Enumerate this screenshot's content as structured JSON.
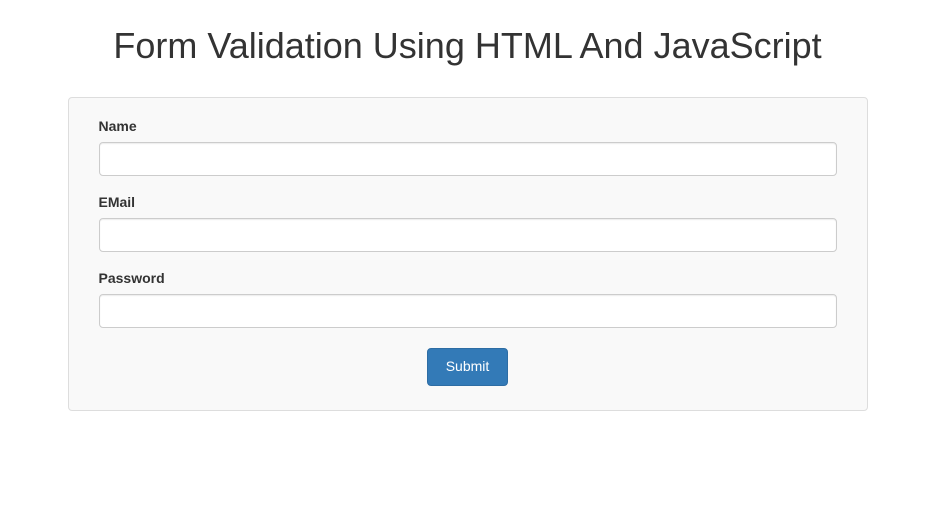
{
  "page_title": "Form Validation Using HTML And JavaScript",
  "form": {
    "name": {
      "label": "Name",
      "value": ""
    },
    "email": {
      "label": "EMail",
      "value": ""
    },
    "password": {
      "label": "Password",
      "value": ""
    },
    "submit_label": "Submit"
  }
}
